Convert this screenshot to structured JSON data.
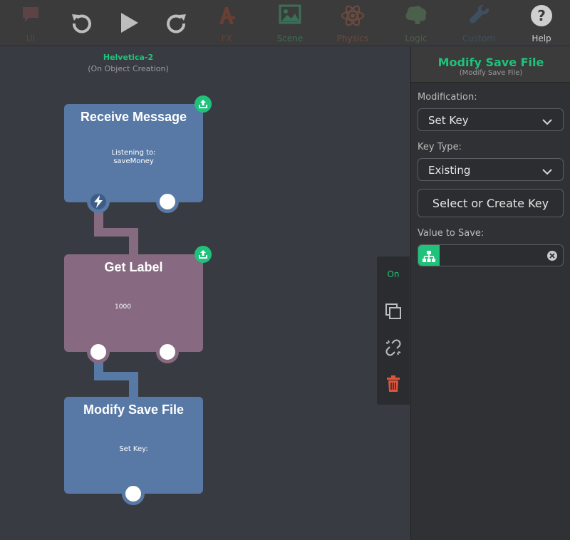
{
  "toolbar": {
    "ui_label": "UI",
    "fx_label": "FX",
    "scene_label": "Scene",
    "physics_label": "Physics",
    "logic_label": "Logic",
    "custom_label": "Custom",
    "help_label": "Help"
  },
  "canvas": {
    "object_name": "Helvetica-2",
    "trigger": "(On Object Creation)"
  },
  "nodes": [
    {
      "title": "Receive Message",
      "body_line1": "Listening to:",
      "body_line2": "saveMoney"
    },
    {
      "title": "Get Label",
      "body_line1": "1000"
    },
    {
      "title": "Modify Save File",
      "body_line1": "Set Key:"
    }
  ],
  "side_toolbar": {
    "status": "On"
  },
  "panel": {
    "title": "Modify Save File",
    "subtitle": "(Modify Save File)",
    "modification_label": "Modification:",
    "modification_value": "Set Key",
    "key_type_label": "Key Type:",
    "key_type_value": "Existing",
    "select_key_button": "Select or Create Key",
    "value_label": "Value to Save:",
    "value_input": ""
  },
  "colors": {
    "accent": "#1fc27a",
    "node_blue": "#5879a5",
    "node_mauve": "#876a82",
    "danger": "#e0543c"
  }
}
